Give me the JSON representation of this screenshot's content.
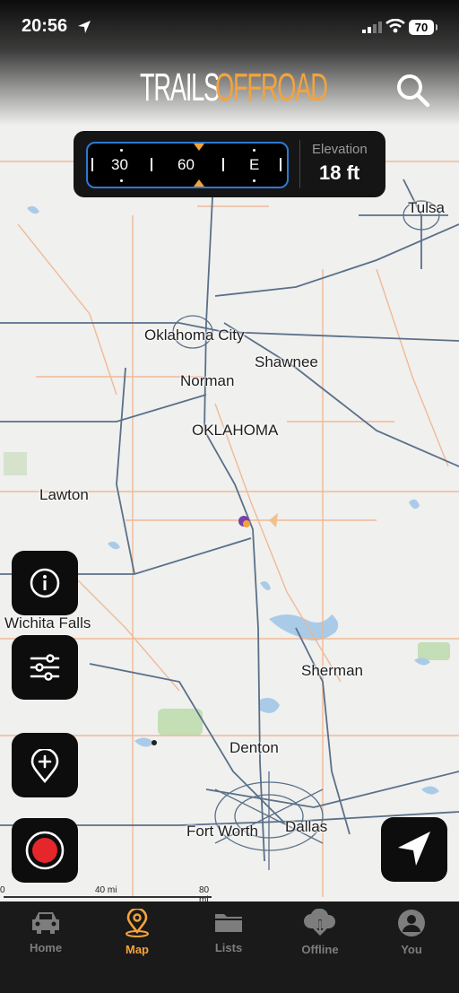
{
  "status_bar": {
    "time": "20:56",
    "battery": "70"
  },
  "header": {
    "logo_trails": "TRAILS",
    "logo_offroad": "OFFROAD"
  },
  "compass": {
    "marks": [
      "30",
      "60",
      "E"
    ]
  },
  "elevation": {
    "label": "Elevation",
    "value": "18 ft"
  },
  "map": {
    "labels": {
      "tulsa": "Tulsa",
      "oklahoma_city": "Oklahoma City",
      "shawnee": "Shawnee",
      "norman": "Norman",
      "oklahoma": "OKLAHOMA",
      "lawton": "Lawton",
      "wichita_falls": "Wichita Falls",
      "sherman": "Sherman",
      "denton": "Denton",
      "fort_worth": "Fort Worth",
      "dallas": "Dallas"
    },
    "scale": {
      "zero": "0",
      "mid": "40 mi",
      "end": "80 mi"
    }
  },
  "tabs": [
    {
      "label": "Home",
      "icon": "car-icon",
      "active": false
    },
    {
      "label": "Map",
      "icon": "map-pin-icon",
      "active": true
    },
    {
      "label": "Lists",
      "icon": "folder-icon",
      "active": false
    },
    {
      "label": "Offline",
      "icon": "cloud-download-icon",
      "active": false
    },
    {
      "label": "You",
      "icon": "user-icon",
      "active": false
    }
  ],
  "colors": {
    "accent": "#f4a33c",
    "compass_border": "#2f7ad1",
    "record": "#e5262b",
    "panel": "#151515"
  }
}
